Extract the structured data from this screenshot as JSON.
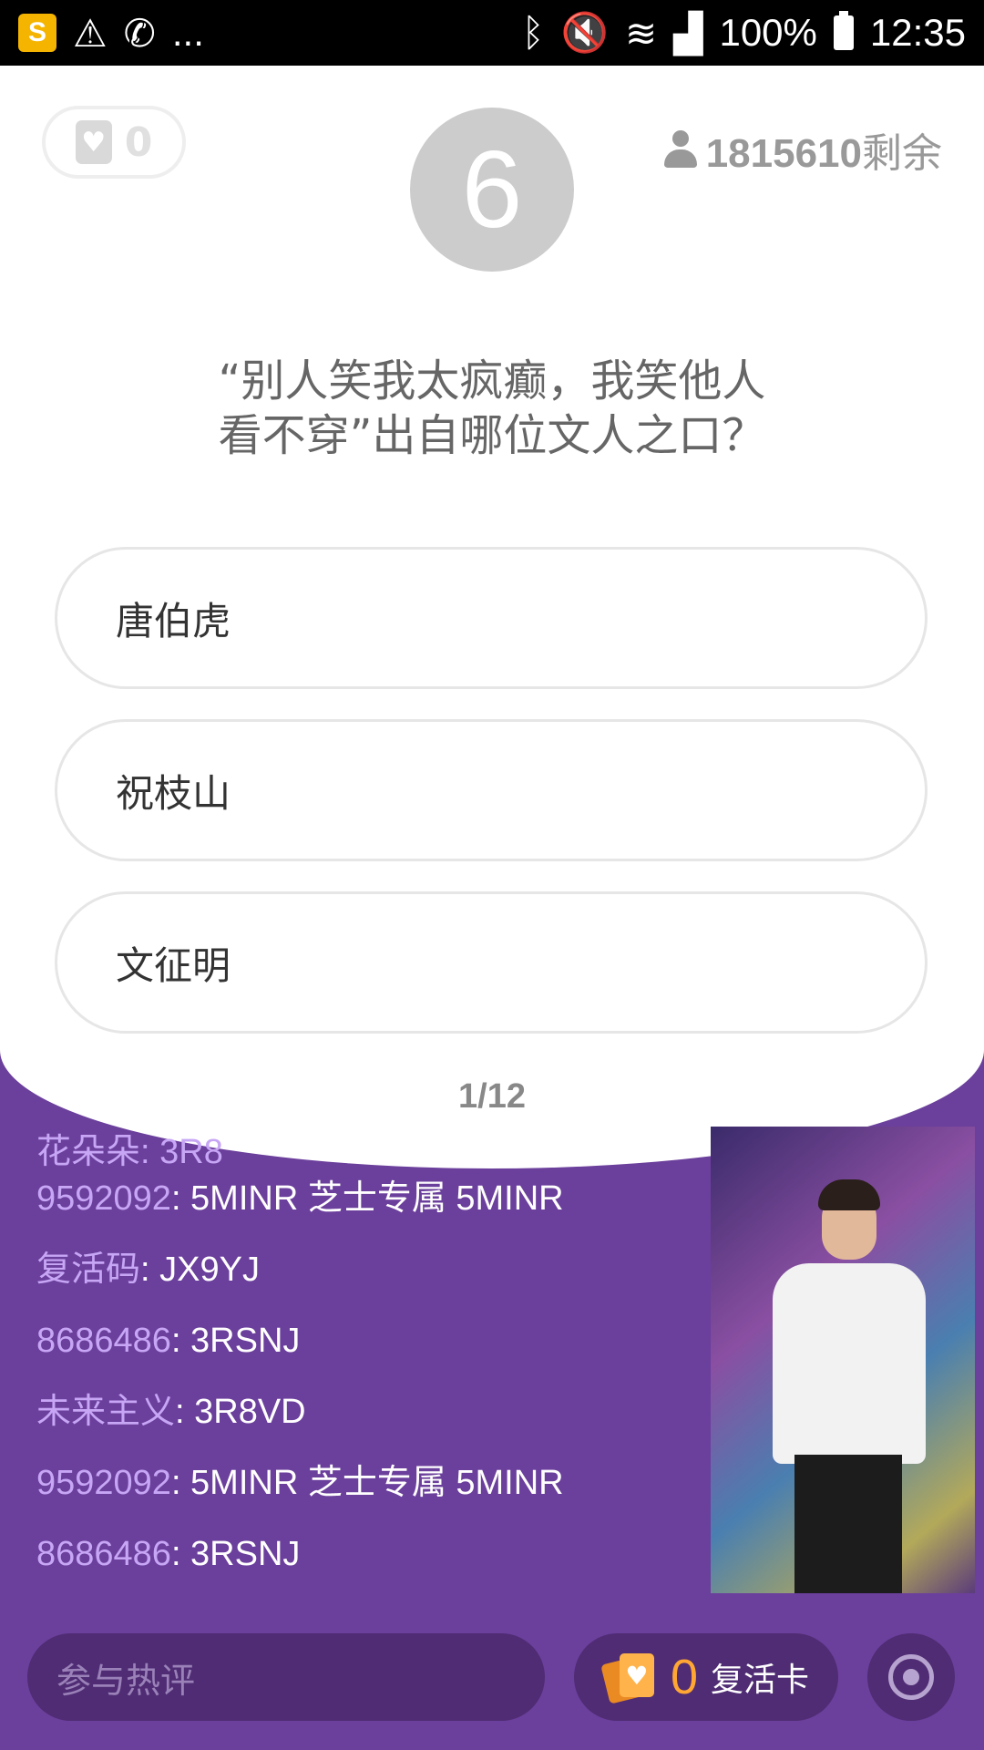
{
  "status_bar": {
    "ellipsis": "...",
    "battery": "100%",
    "time": "12:35",
    "icons": [
      "app-notification-icon",
      "warning-icon",
      "phone-location-icon",
      "bluetooth-icon",
      "mute-icon",
      "wifi-icon",
      "signal-icon",
      "battery-icon"
    ]
  },
  "header": {
    "lives_count": "0",
    "timer": "6",
    "remaining_count": "1815610",
    "remaining_label": "剩余"
  },
  "question": {
    "line1": "“别人笑我太疯癫，我笑他人",
    "line2": "看不穿”出自哪位文人之口？"
  },
  "options": [
    {
      "label": "唐伯虎"
    },
    {
      "label": "祝枝山"
    },
    {
      "label": "文征明"
    }
  ],
  "progress": "1/12",
  "comments": {
    "peek": "花朵朵: 3R8",
    "rows": [
      {
        "name": "9592092",
        "text": ": 5MINR 芝士专属 5MINR"
      },
      {
        "name": "复活码",
        "text": ": JX9YJ"
      },
      {
        "name": "8686486",
        "text": ": 3RSNJ"
      },
      {
        "name": "未来主义",
        "text": ": 3R8VD"
      },
      {
        "name": "9592092",
        "text": ": 5MINR 芝士专属 5MINR"
      },
      {
        "name": "8686486",
        "text": ": 3RSNJ"
      }
    ]
  },
  "bottom": {
    "comment_placeholder": "参与热评",
    "revive_count": "0",
    "revive_label": "复活卡"
  },
  "colors": {
    "purple_bg": "#6b3f9c",
    "pill_bg": "#4f2c73",
    "name_color": "#c7a6f5",
    "accent_orange": "#ffa633"
  }
}
